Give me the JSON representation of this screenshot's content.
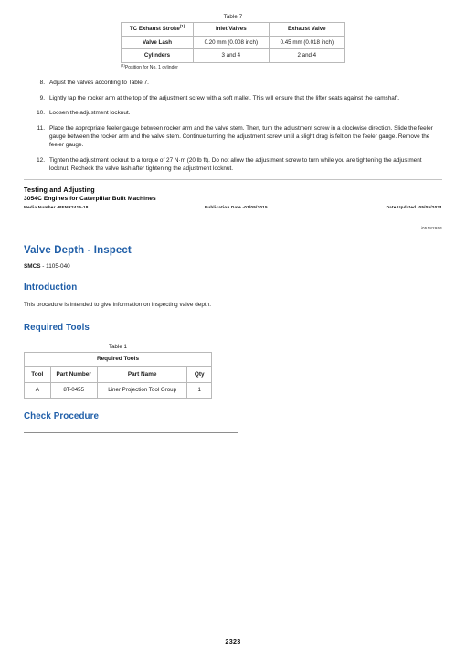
{
  "table7": {
    "caption": "Table 7",
    "header": [
      "TC Exhaust Stroke",
      "Inlet Valves",
      "Exhaust Valve"
    ],
    "header_footnote_marker": "(1)",
    "rows": [
      {
        "label": "Valve Lash",
        "inlet": "0.20 mm (0.008 inch)",
        "exhaust": "0.45 mm (0.018 inch)"
      },
      {
        "label": "Cylinders",
        "inlet": "3 and 4",
        "exhaust": "2 and 4"
      }
    ],
    "footnote_marker": "(1)",
    "footnote": "Position for No. 1 cylinder"
  },
  "steps": [
    {
      "num": "8.",
      "text": "Adjust the valves according to Table 7."
    },
    {
      "num": "9.",
      "text": "Lightly tap the rocker arm at the top of the adjustment screw with a soft mallet. This will ensure that the lifter seats against the camshaft."
    },
    {
      "num": "10.",
      "text": "Loosen the adjustment locknut."
    },
    {
      "num": "11.",
      "text": "Place the appropriate feeler gauge between rocker arm and the valve stem. Then, turn the adjustment screw in a clockwise direction. Slide the feeler gauge between the rocker arm and the valve stem. Continue turning the adjustment screw until a slight drag is felt on the feeler gauge. Remove the feeler gauge."
    },
    {
      "num": "12.",
      "text": "Tighten the adjustment locknut to a torque of 27 N·m (20 lb ft). Do not allow the adjustment screw to turn while you are tightening the adjustment locknut. Recheck the valve lash after tightening the adjustment locknut."
    }
  ],
  "footer": {
    "title": "Testing and Adjusting",
    "subtitle": "3054C Engines for Caterpillar Built Machines",
    "media_number": "Media Number -RENR2415-18",
    "publication_date": "Publication Date -01/05/2015",
    "date_updated": "Date Updated -05/05/2021",
    "doc_id": "i05182954"
  },
  "section": {
    "title": "Valve Depth - Inspect",
    "smcs_label": "SMCS",
    "smcs_value": "- 1105-040",
    "introduction_heading": "Introduction",
    "introduction_text": "This procedure is intended to give information on inspecting valve depth.",
    "required_tools_heading": "Required Tools",
    "check_procedure_heading": "Check Procedure"
  },
  "table1": {
    "caption": "Table 1",
    "title": "Required Tools",
    "columns": [
      "Tool",
      "Part Number",
      "Part Name",
      "Qty"
    ],
    "rows": [
      {
        "tool": "A",
        "part_number": "8T-0455",
        "part_name": "Liner Projection Tool Group",
        "qty": "1"
      }
    ]
  },
  "page_number": "2323",
  "colors": {
    "heading_blue": "#1f5ea8",
    "table_border": "#b9b9b9",
    "rule": "#c4c4c4"
  }
}
